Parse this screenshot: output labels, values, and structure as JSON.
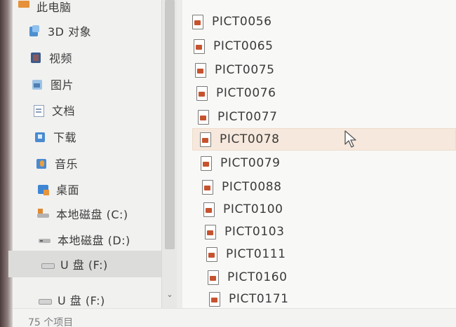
{
  "sidebar": {
    "items": [
      {
        "label": "此电脑",
        "icon": "this-pc-icon"
      },
      {
        "label": "3D 对象",
        "icon": "3d-objects-icon"
      },
      {
        "label": "视频",
        "icon": "video-folder-icon"
      },
      {
        "label": "图片",
        "icon": "pictures-folder-icon"
      },
      {
        "label": "文档",
        "icon": "documents-folder-icon"
      },
      {
        "label": "下载",
        "icon": "downloads-folder-icon"
      },
      {
        "label": "音乐",
        "icon": "music-folder-icon"
      },
      {
        "label": "桌面",
        "icon": "desktop-folder-icon"
      },
      {
        "label": "本地磁盘 (C:)",
        "icon": "drive-c-icon"
      },
      {
        "label": "本地磁盘 (D:)",
        "icon": "drive-d-icon"
      },
      {
        "label": "U 盘 (F:)",
        "icon": "usb-drive-icon"
      },
      {
        "label": "U 盘 (F:)",
        "icon": "usb-drive-icon"
      }
    ],
    "selected_index": 10
  },
  "files": {
    "items": [
      {
        "name": "PICT0056"
      },
      {
        "name": "PICT0065"
      },
      {
        "name": "PICT0075"
      },
      {
        "name": "PICT0076"
      },
      {
        "name": "PICT0077"
      },
      {
        "name": "PICT0078"
      },
      {
        "name": "PICT0079"
      },
      {
        "name": "PICT0088"
      },
      {
        "name": "PICT0100"
      },
      {
        "name": "PICT0103"
      },
      {
        "name": "PICT0111"
      },
      {
        "name": "PICT0160"
      },
      {
        "name": "PICT0171"
      }
    ],
    "hovered_index": 5,
    "icon": "image-file-icon"
  },
  "status_bar": {
    "item_count": "75 个项目"
  },
  "colors": {
    "hover_highlight": "#f6e8dc",
    "nav_selected": "#dcdcdb",
    "file_icon_accent": "#c6532f"
  }
}
